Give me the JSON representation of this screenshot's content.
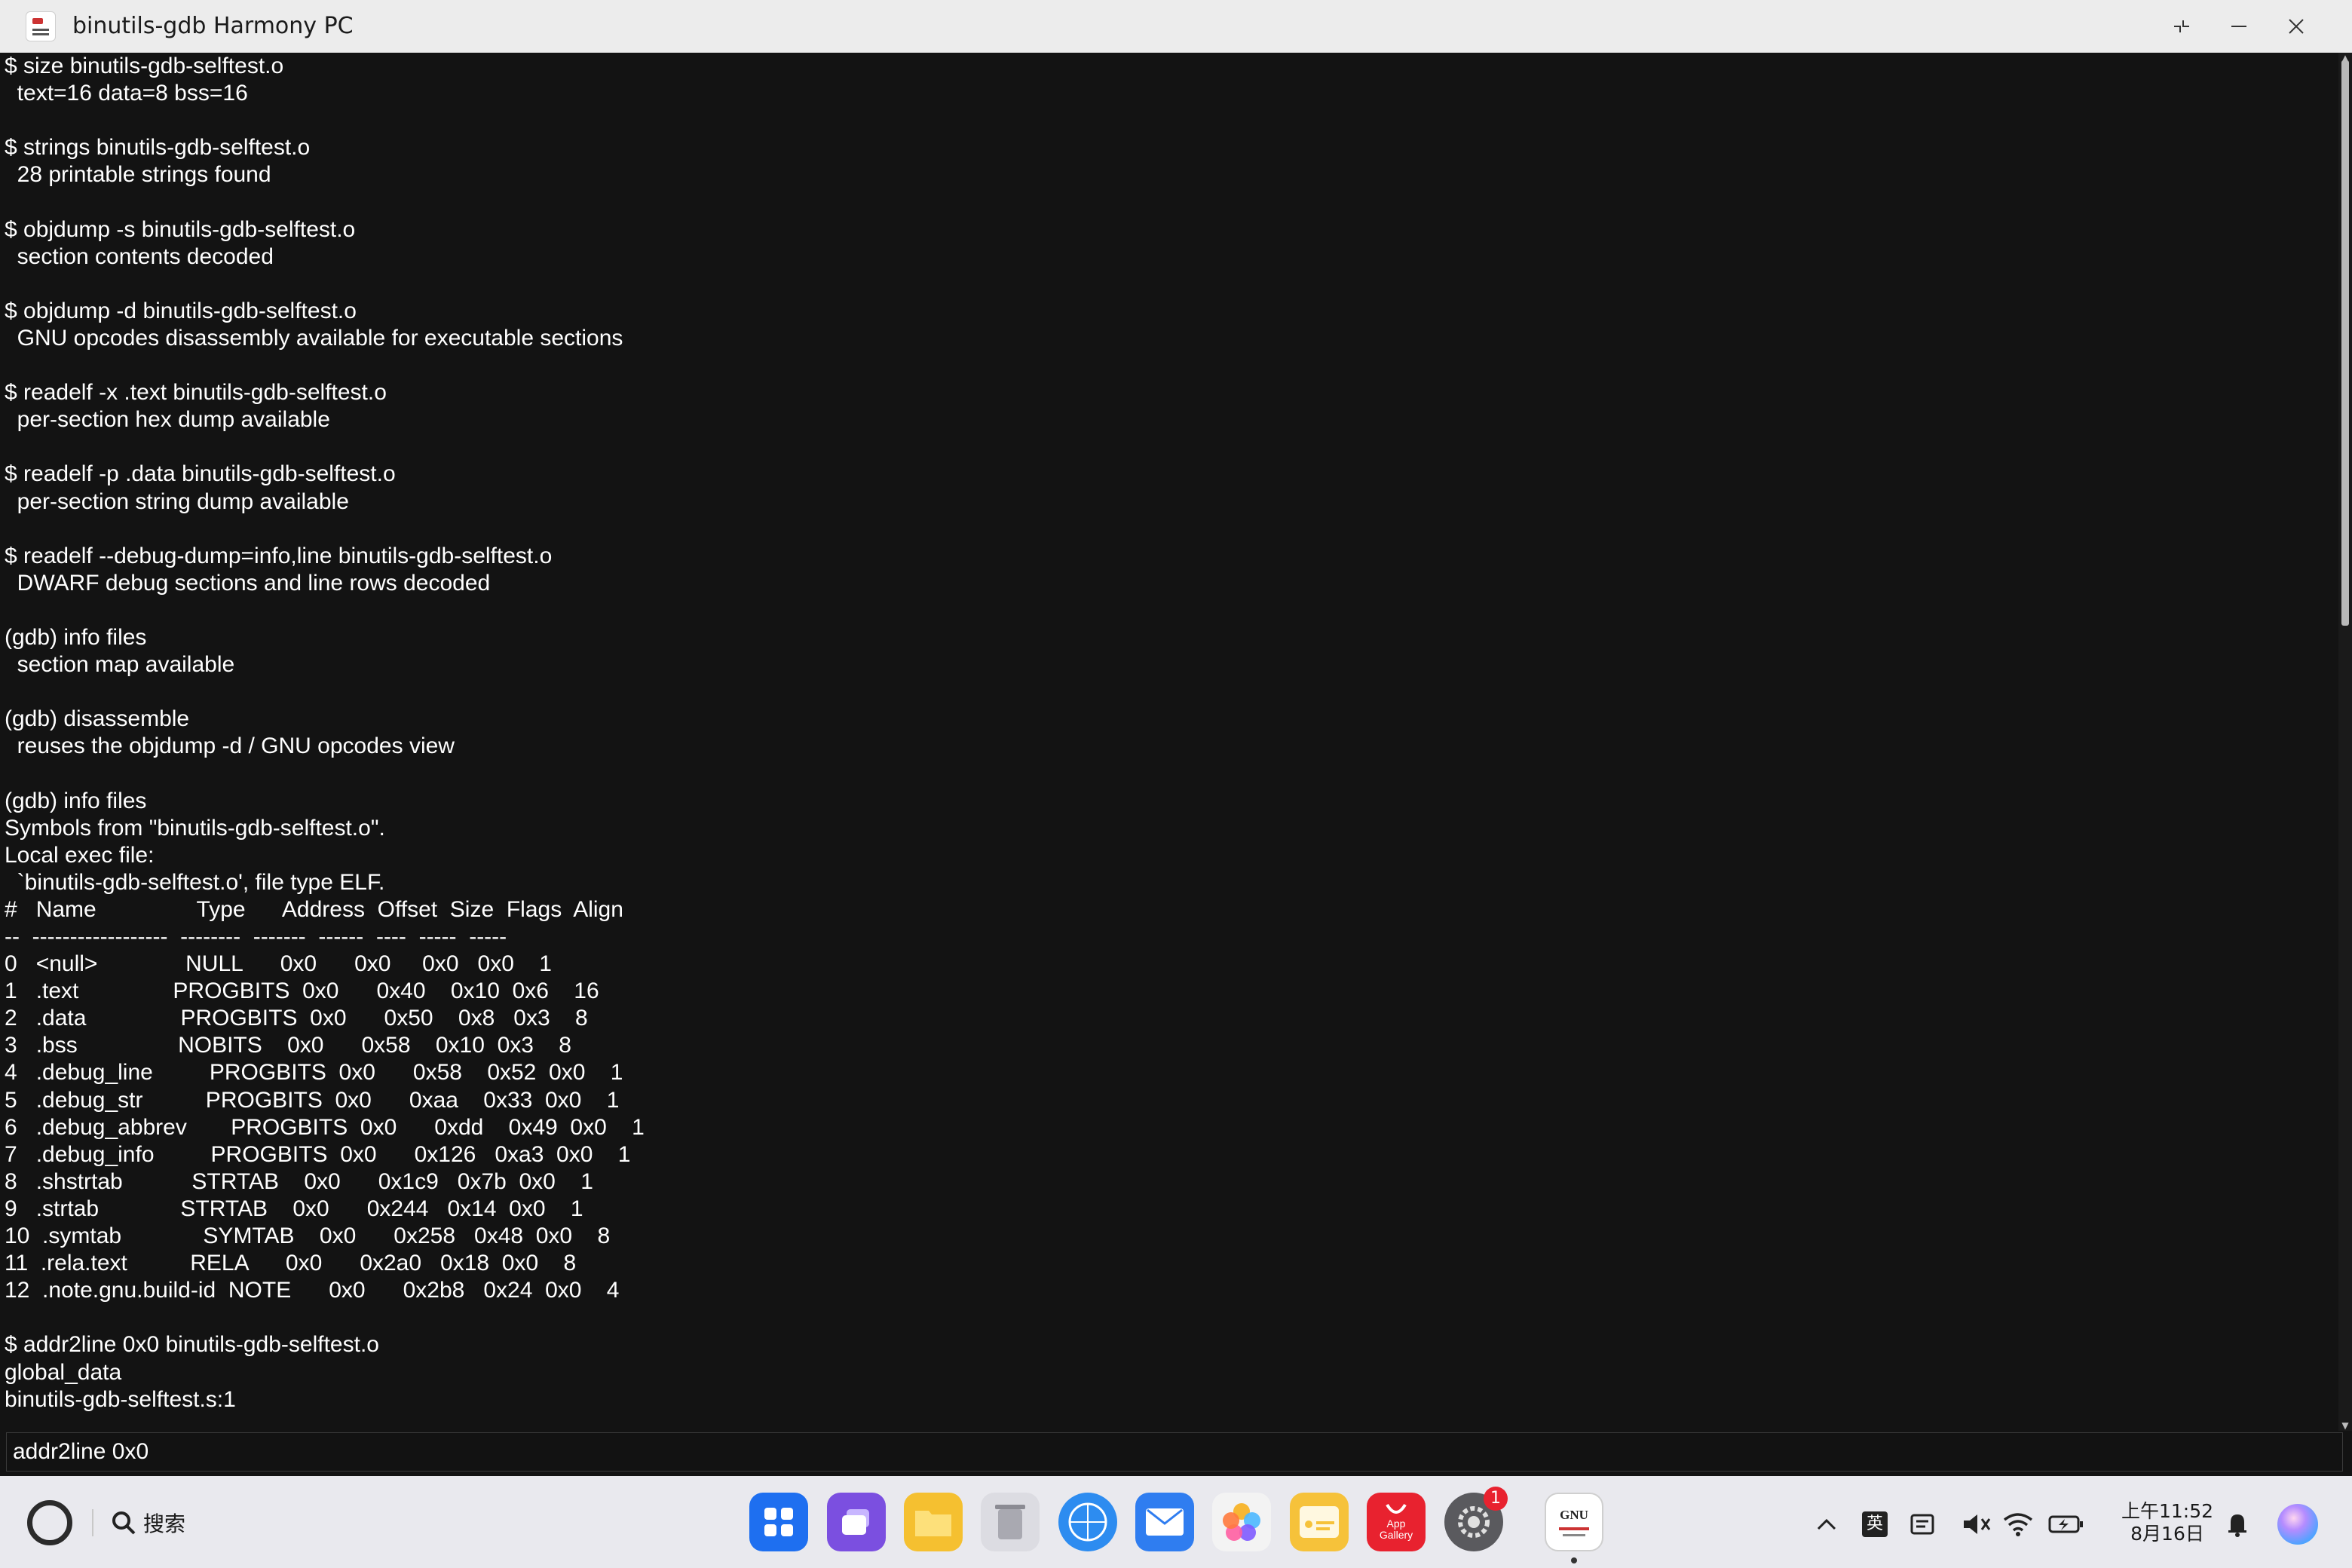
{
  "window": {
    "title": "binutils-gdb Harmony PC",
    "app_icon": "gnu-app-icon",
    "controls": [
      "restore-icon",
      "minimize-icon",
      "close-icon"
    ]
  },
  "terminal": {
    "lines": [
      "$ size binutils-gdb-selftest.o",
      "  text=16 data=8 bss=16",
      "",
      "$ strings binutils-gdb-selftest.o",
      "  28 printable strings found",
      "",
      "$ objdump -s binutils-gdb-selftest.o",
      "  section contents decoded",
      "",
      "$ objdump -d binutils-gdb-selftest.o",
      "  GNU opcodes disassembly available for executable sections",
      "",
      "$ readelf -x .text binutils-gdb-selftest.o",
      "  per-section hex dump available",
      "",
      "$ readelf -p .data binutils-gdb-selftest.o",
      "  per-section string dump available",
      "",
      "$ readelf --debug-dump=info,line binutils-gdb-selftest.o",
      "  DWARF debug sections and line rows decoded",
      "",
      "(gdb) info files",
      "  section map available",
      "",
      "(gdb) disassemble",
      "  reuses the objdump -d / GNU opcodes view",
      "",
      "(gdb) info files",
      "Symbols from \"binutils-gdb-selftest.o\".",
      "Local exec file:",
      "  `binutils-gdb-selftest.o', file type ELF.",
      "#   Name                Type      Address  Offset  Size  Flags  Align",
      "--  ------------------  --------  -------  ------  ----  -----  -----",
      "0   <null>              NULL      0x0      0x0     0x0   0x0    1",
      "1   .text               PROGBITS  0x0      0x40    0x10  0x6    16",
      "2   .data               PROGBITS  0x0      0x50    0x8   0x3    8",
      "3   .bss                NOBITS    0x0      0x58    0x10  0x3    8",
      "4   .debug_line         PROGBITS  0x0      0x58    0x52  0x0    1",
      "5   .debug_str          PROGBITS  0x0      0xaa    0x33  0x0    1",
      "6   .debug_abbrev       PROGBITS  0x0      0xdd    0x49  0x0    1",
      "7   .debug_info         PROGBITS  0x0      0x126   0xa3  0x0    1",
      "8   .shstrtab           STRTAB    0x0      0x1c9   0x7b  0x0    1",
      "9   .strtab             STRTAB    0x0      0x244   0x14  0x0    1",
      "10  .symtab             SYMTAB    0x0      0x258   0x48  0x0    8",
      "11  .rela.text          RELA      0x0      0x2a0   0x18  0x0    8",
      "12  .note.gnu.build-id  NOTE      0x0      0x2b8   0x24  0x0    4",
      "",
      "$ addr2line 0x0 binutils-gdb-selftest.o",
      "global_data",
      "binutils-gdb-selftest.s:1"
    ]
  },
  "command_input": {
    "value": "addr2line 0x0"
  },
  "taskbar": {
    "search_label": "搜索",
    "dock": [
      {
        "name": "app-launcher-icon",
        "color": "#1e6ff0"
      },
      {
        "name": "multitask-icon",
        "color": "#7b4fe0"
      },
      {
        "name": "files-folder-icon",
        "color": "#f5c030"
      },
      {
        "name": "recycle-bin-icon",
        "color": "#cfcfd4"
      },
      {
        "name": "browser-icon",
        "color": "#2d8cf0"
      },
      {
        "name": "mail-icon",
        "color": "#2f7df0"
      },
      {
        "name": "gallery-icon",
        "color": "#f3f3f3"
      },
      {
        "name": "notes-icon",
        "color": "#f6c23a"
      },
      {
        "name": "app-gallery-icon",
        "color": "#e8222f",
        "label": "App Gallery"
      },
      {
        "name": "settings-icon",
        "color": "#5a5a5e",
        "badge": "1"
      },
      {
        "name": "gnu-binutils-gdb-icon",
        "color": "#ffffff",
        "label": "GNU"
      }
    ],
    "tray": {
      "ime_label": "英",
      "time": "上午11:52",
      "date": "8月16日"
    }
  }
}
